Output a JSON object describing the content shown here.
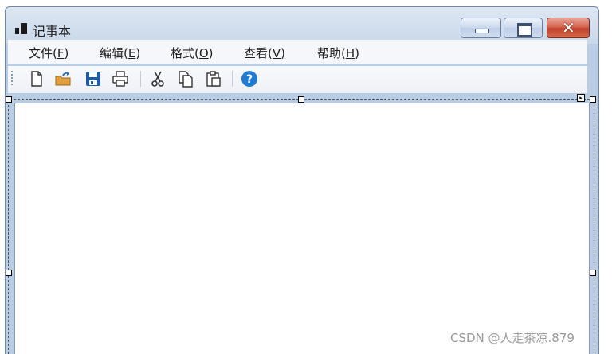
{
  "window": {
    "title": "记事本",
    "controls": {
      "minimize": "minimize",
      "maximize": "maximize",
      "close": "close"
    }
  },
  "menu": [
    {
      "label": "文件(",
      "mnemonic": "F",
      "end": ")"
    },
    {
      "label": "编辑(",
      "mnemonic": "E",
      "end": ")"
    },
    {
      "label": "格式(",
      "mnemonic": "O",
      "end": ")"
    },
    {
      "label": "查看(",
      "mnemonic": "V",
      "end": ")"
    },
    {
      "label": "帮助(",
      "mnemonic": "H",
      "end": ")"
    }
  ],
  "toolbar": {
    "buttons": [
      {
        "icon": "new-document-icon"
      },
      {
        "icon": "open-folder-icon"
      },
      {
        "icon": "save-icon"
      },
      {
        "icon": "print-icon"
      },
      {
        "icon": "cut-icon"
      },
      {
        "icon": "copy-icon"
      },
      {
        "icon": "paste-icon"
      },
      {
        "icon": "help-icon"
      }
    ]
  },
  "editor": {
    "text": ""
  },
  "watermark": "CSDN @人走茶凉.879",
  "colors": {
    "titlebar": "#c9d8ea",
    "close_button": "#c2412a",
    "save_icon": "#1e5aa8",
    "open_folder_icon": "#e0a040",
    "help_icon": "#1e7ad6"
  }
}
